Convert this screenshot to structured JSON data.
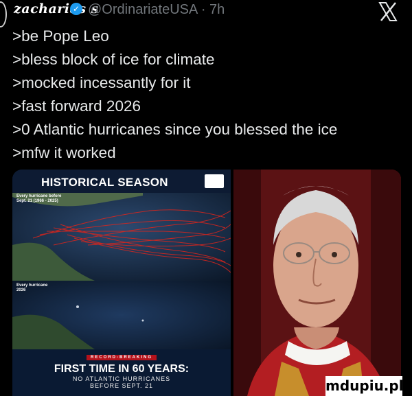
{
  "post": {
    "display_name": "zacharias s",
    "handle_time": "@OrdinariateUSA · 7h",
    "lines": [
      ">be Pope Leo",
      ">bless block of ice for climate",
      ">mocked incessantly for it",
      ">fast forward 2026",
      ">0 Atlantic hurricanes since you blessed the ice",
      ">mfw it worked"
    ]
  },
  "map_image": {
    "title": "HISTORICAL SEASON",
    "label_top": "Every hurricane before Sept. 21 (1966 - 2025)",
    "label_mid": "Every hurricane 2026",
    "chip": "RECORD-BREAKING",
    "headline": "FIRST TIME IN 60 YEARS:",
    "sub1": "NO ATLANTIC HURRICANES",
    "sub2": "BEFORE SEPT. 21"
  },
  "watermark": "mdupiu.pl",
  "colors": {
    "verified": "#1d9bf0",
    "muted": "#71767b",
    "text": "#e7e9ea",
    "hurricane_tracks": "#e0251b"
  },
  "icons": {
    "close": "x-logo-icon",
    "verified": "verified-badge-icon"
  }
}
